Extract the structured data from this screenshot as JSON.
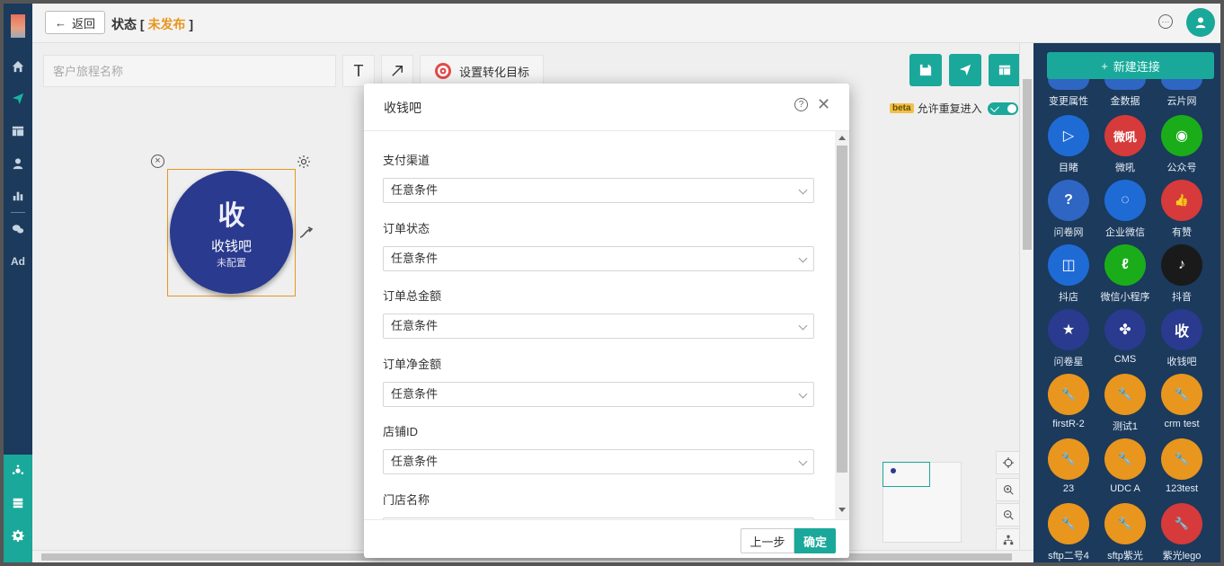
{
  "header": {
    "back_label": "返回",
    "status_label": "状态 [",
    "status_value": "未发布",
    "status_close": "]"
  },
  "toolbar": {
    "journey_placeholder": "客户旅程名称",
    "text_tool": "T",
    "goal_label": "设置转化目标"
  },
  "canvas": {
    "repeat_beta": "beta",
    "repeat_label": "允许重复进入",
    "node": {
      "glyph": "收",
      "name": "收钱吧",
      "status": "未配置"
    }
  },
  "palette": {
    "new_connection": "新建连接",
    "items": [
      {
        "label": "变更属性",
        "color": "#2f66c4",
        "glyph": ""
      },
      {
        "label": "金数据",
        "color": "#2f66c4",
        "glyph": ""
      },
      {
        "label": "云片网",
        "color": "#2f66c4",
        "glyph": ""
      },
      {
        "label": "目睹",
        "color": "#1f6bd6",
        "glyph": "▷"
      },
      {
        "label": "微吼",
        "color": "#d63a3a",
        "glyph": "微吼"
      },
      {
        "label": "公众号",
        "color": "#1aad19",
        "glyph": "◉"
      },
      {
        "label": "问卷网",
        "color": "#2f66c4",
        "glyph": "?"
      },
      {
        "label": "企业微信",
        "color": "#1f6bd6",
        "glyph": "◌"
      },
      {
        "label": "有赞",
        "color": "#d63a3a",
        "glyph": "👍"
      },
      {
        "label": "抖店",
        "color": "#1f6bd6",
        "glyph": "◫"
      },
      {
        "label": "微信小程序",
        "color": "#1aad19",
        "glyph": "ℓ"
      },
      {
        "label": "抖音",
        "color": "#1a1a1a",
        "glyph": "♪"
      },
      {
        "label": "问卷星",
        "color": "#2a3a8e",
        "glyph": "★"
      },
      {
        "label": "CMS",
        "color": "#2a3a8e",
        "glyph": "✤"
      },
      {
        "label": "收钱吧",
        "color": "#2a3a8e",
        "glyph": "收"
      },
      {
        "label": "firstR-2",
        "color": "#e8961e",
        "glyph": "🔧"
      },
      {
        "label": "测试1",
        "color": "#e8961e",
        "glyph": "🔧"
      },
      {
        "label": "crm test",
        "color": "#e8961e",
        "glyph": "🔧"
      },
      {
        "label": "23",
        "color": "#e8961e",
        "glyph": "🔧"
      },
      {
        "label": "UDC A",
        "color": "#e8961e",
        "glyph": "🔧"
      },
      {
        "label": "123test",
        "color": "#e8961e",
        "glyph": "🔧"
      },
      {
        "label": "sftp二号4",
        "color": "#e8961e",
        "glyph": "🔧"
      },
      {
        "label": "sftp紫光",
        "color": "#e8961e",
        "glyph": "🔧"
      },
      {
        "label": "紫光lego",
        "color": "#d63a3a",
        "glyph": "🔧"
      }
    ]
  },
  "modal": {
    "title": "收钱吧",
    "fields": [
      {
        "label": "支付渠道",
        "value": "任意条件"
      },
      {
        "label": "订单状态",
        "value": "任意条件"
      },
      {
        "label": "订单总金额",
        "value": "任意条件"
      },
      {
        "label": "订单净金额",
        "value": "任意条件"
      },
      {
        "label": "店铺ID",
        "value": "任意条件"
      },
      {
        "label": "门店名称",
        "value": ""
      }
    ],
    "prev_label": "上一步",
    "confirm_label": "确定"
  }
}
